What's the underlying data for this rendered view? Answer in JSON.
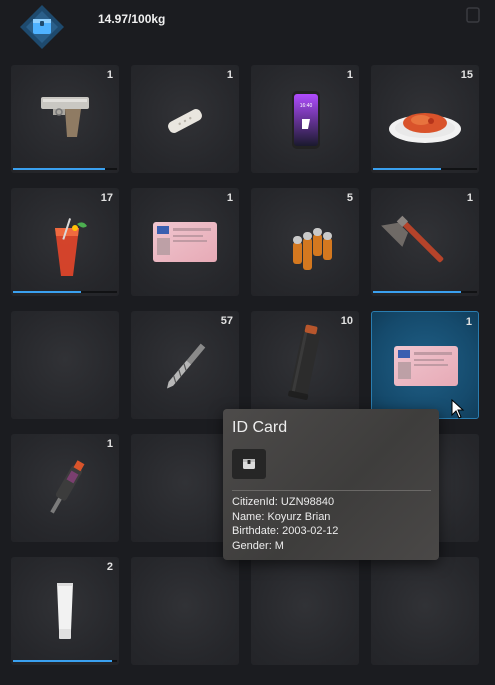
{
  "header": {
    "weight": "14.97/100kg"
  },
  "slots": [
    {
      "count": "1",
      "item_icon": "pistol-icon",
      "durability": 0.88
    },
    {
      "count": "1",
      "item_icon": "bandage-icon"
    },
    {
      "count": "1",
      "item_icon": "phone-icon"
    },
    {
      "count": "15",
      "item_icon": "spaghetti-icon",
      "durability": 0.65
    },
    {
      "count": "17",
      "item_icon": "cocktail-icon",
      "durability": 0.65
    },
    {
      "count": "1",
      "item_icon": "id-card-icon"
    },
    {
      "count": "5",
      "item_icon": "ammo-icon"
    },
    {
      "count": "1",
      "item_icon": "axe-icon",
      "durability": 0.85
    },
    {
      "count": "",
      "item_icon": ""
    },
    {
      "count": "57",
      "item_icon": "drill-bit-icon"
    },
    {
      "count": "10",
      "item_icon": "magazine-icon"
    },
    {
      "count": "1",
      "item_icon": "id-card-icon",
      "selected": true
    },
    {
      "count": "1",
      "item_icon": "tool-icon"
    },
    {
      "count": "",
      "item_icon": ""
    },
    {
      "count": "",
      "item_icon": ""
    },
    {
      "count": "",
      "item_icon": ""
    },
    {
      "count": "2",
      "item_icon": "tube-icon",
      "durability": 0.95
    },
    {
      "count": "",
      "item_icon": ""
    },
    {
      "count": "",
      "item_icon": ""
    },
    {
      "count": "",
      "item_icon": ""
    }
  ],
  "tooltip": {
    "title": "ID Card",
    "icon": "box-icon",
    "citizen_id": "CitizenId: UZN98840",
    "name": "Name: Koyurz Brian",
    "birthdate": "Birthdate: 2003-02-12",
    "gender": "Gender: M"
  },
  "colors": {
    "accent": "#3aa0ef",
    "selected": "#1a5a80",
    "background": "#1b1c20"
  }
}
